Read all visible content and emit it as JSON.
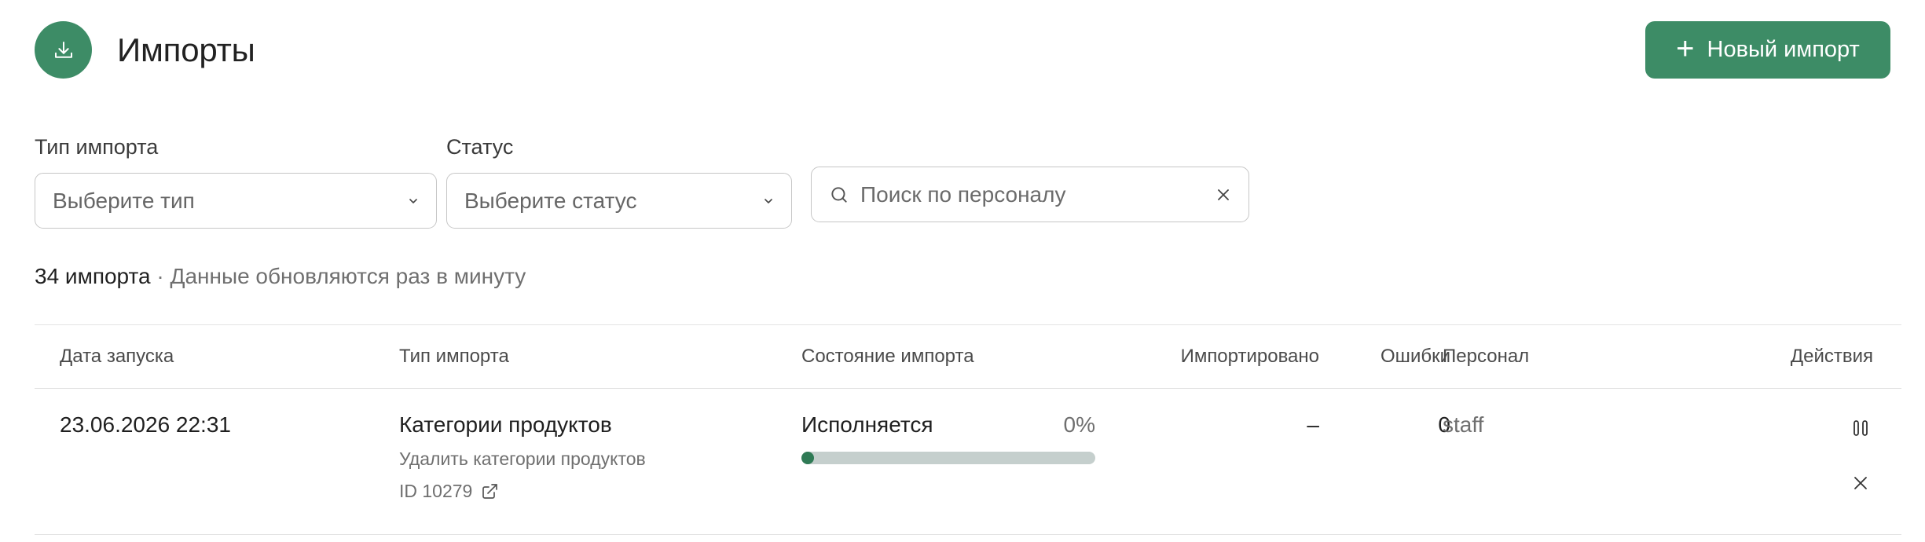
{
  "header": {
    "title": "Импорты",
    "new_button_label": "Новый импорт",
    "icon": "download-icon",
    "accent_color": "#3d8c66"
  },
  "filters": {
    "type": {
      "label": "Тип импорта",
      "placeholder": "Выберите тип"
    },
    "status": {
      "label": "Статус",
      "placeholder": "Выберите статус"
    },
    "search": {
      "placeholder": "Поиск по персоналу"
    }
  },
  "summary": {
    "count": "34 импорта",
    "separator": "·",
    "note": "Данные обновляются раз в минуту"
  },
  "table": {
    "columns": {
      "date": "Дата запуска",
      "type": "Тип импорта",
      "state": "Состояние импорта",
      "imported": "Импортировано",
      "errors": "Ошибки",
      "staff": "Персонал",
      "actions": "Действия"
    },
    "rows": [
      {
        "date": "23.06.2026 22:31",
        "type_name": "Категории продуктов",
        "type_sub": "Удалить категории продуктов",
        "id_label": "ID 10279",
        "state": "Исполняется",
        "progress_text": "0%",
        "progress": 0,
        "imported": "–",
        "errors": "0",
        "staff": "staff"
      }
    ]
  }
}
